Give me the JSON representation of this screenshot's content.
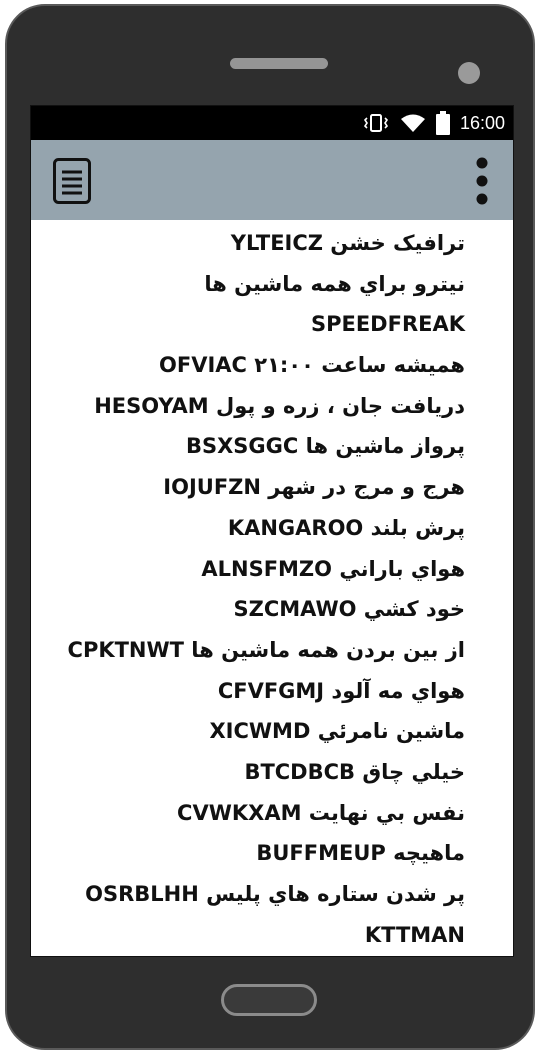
{
  "status_bar": {
    "time": "16:00",
    "icons": [
      "vibrate-icon",
      "wifi-icon",
      "battery-icon"
    ]
  },
  "app_bar": {
    "left_icon": "document-menu-icon",
    "right_icon": "more-vert-icon",
    "color": "#95a4ae"
  },
  "cheats": [
    "ترافیک خشن YLTEICZ",
    "نیترو براي همه ماشین ها",
    "SPEEDFREAK",
    "همیشه ساعت ۲۱:۰۰ OFVIAC",
    "دریافت جان ، زره و پول HESOYAM",
    "پرواز ماشین ها BSXSGGC",
    "هرج و مرج در شهر IOJUFZN",
    "پرش بلند KANGAROO",
    "هواي باراني ALNSFMZO",
    "خود کشي SZCMAWO",
    "از بین بردن همه ماشین ها CPKTNWT",
    "هواي مه آلود CFVFGMJ",
    "ماشین نامرئي XICWMD",
    "خیلي چاق BTCDBCB",
    "نفس بي نهایت CVWKXAM",
    "ماهیچه BUFFMEUP",
    "پر شدن ستاره هاي پلیس OSRBLHH",
    "KTTMAN"
  ]
}
